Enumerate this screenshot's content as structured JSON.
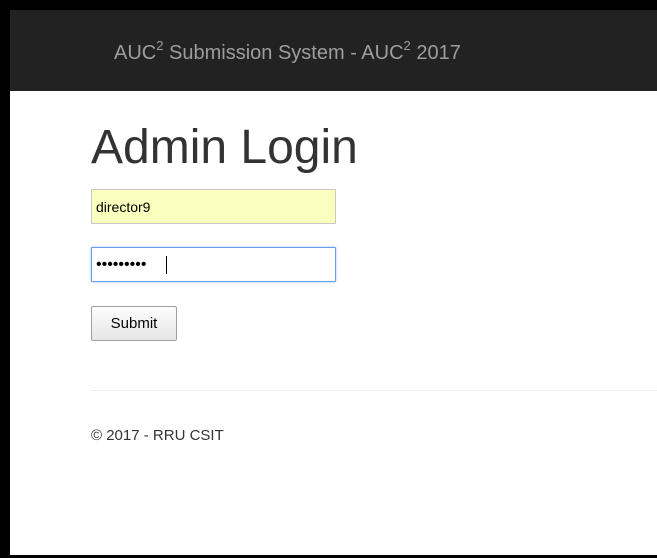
{
  "navbar": {
    "brand_prefix": "AUC",
    "brand_sup_1": "2",
    "brand_middle": " Submission System - AUC",
    "brand_sup_2": "2",
    "brand_suffix": " 2017"
  },
  "main": {
    "title": "Admin Login",
    "username_value": "director9",
    "password_value": "•••••••••",
    "submit_label": "Submit"
  },
  "footer": {
    "text": "© 2017 - RRU CSIT"
  },
  "colors": {
    "navbar_bg": "#222222",
    "brand_text": "#9d9d9d",
    "autofill_bg": "#faffbd",
    "focus_border": "#6d9ee8"
  }
}
